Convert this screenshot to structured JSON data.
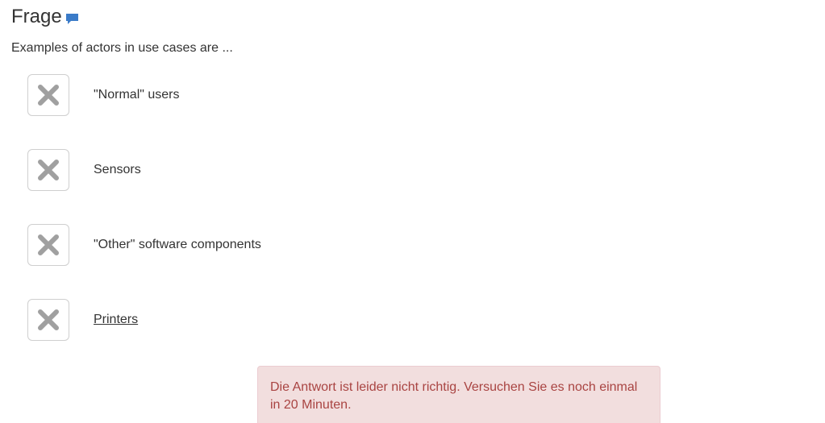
{
  "header": {
    "title": "Frage",
    "comment_icon": "chat-bubble-icon",
    "icon_color": "#3a7bc8"
  },
  "question": {
    "text": "Examples of actors in use cases are ..."
  },
  "options": [
    {
      "label": "\"Normal\" users",
      "state": "x-icon"
    },
    {
      "label": "Sensors",
      "state": "x-icon"
    },
    {
      "label": "\"Other\" software components",
      "state": "x-icon"
    },
    {
      "label": "Printers",
      "state": "x-icon"
    }
  ],
  "feedback": {
    "message": "Die Antwort ist leider nicht richtig. Versuchen Sie es noch einmal in 20 Minuten.",
    "bg_color": "#f2dede",
    "text_color": "#a94442"
  }
}
